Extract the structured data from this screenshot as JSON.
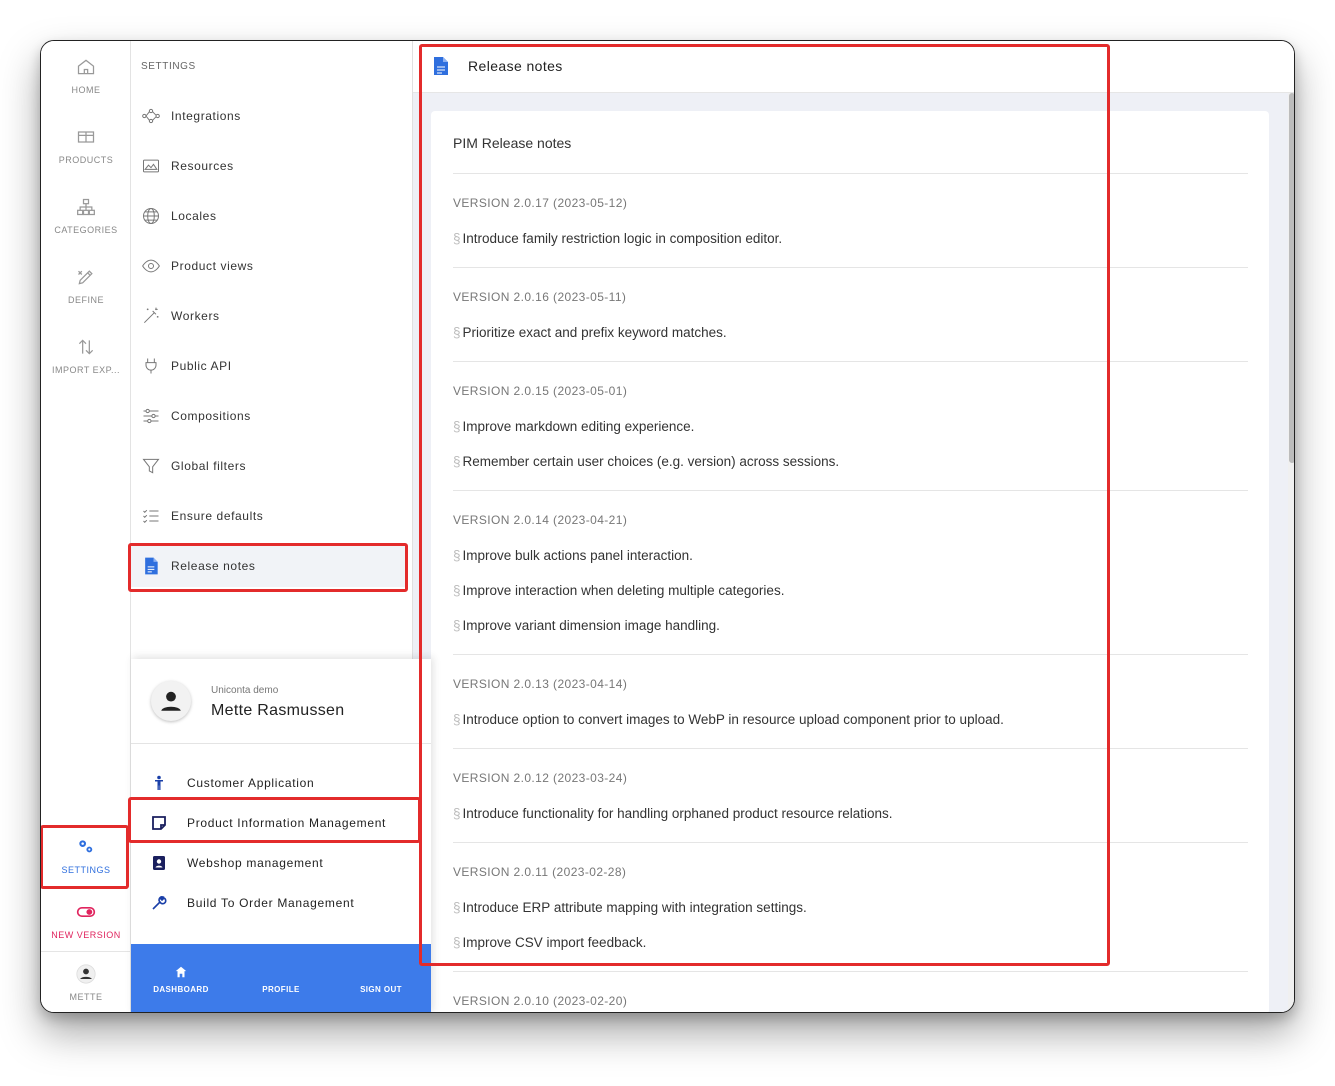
{
  "rail": {
    "items": [
      {
        "label": "HOME",
        "icon": "home-icon"
      },
      {
        "label": "PRODUCTS",
        "icon": "products-icon"
      },
      {
        "label": "CATEGORIES",
        "icon": "categories-icon"
      },
      {
        "label": "DEFINE",
        "icon": "define-icon"
      },
      {
        "label": "IMPORT EXP...",
        "icon": "import-export-icon"
      }
    ],
    "settings_label": "SETTINGS",
    "new_version_label": "NEW VERSION",
    "user_label": "METTE"
  },
  "settings": {
    "title": "SETTINGS",
    "items": [
      {
        "label": "Integrations",
        "icon": "integrations-icon"
      },
      {
        "label": "Resources",
        "icon": "resources-icon"
      },
      {
        "label": "Locales",
        "icon": "globe-icon"
      },
      {
        "label": "Product views",
        "icon": "eye-icon"
      },
      {
        "label": "Workers",
        "icon": "wand-icon"
      },
      {
        "label": "Public API",
        "icon": "plug-icon"
      },
      {
        "label": "Compositions",
        "icon": "sliders-icon"
      },
      {
        "label": "Global filters",
        "icon": "filter-icon"
      },
      {
        "label": "Ensure defaults",
        "icon": "checklist-icon"
      },
      {
        "label": "Release notes",
        "icon": "document-icon",
        "active": true
      }
    ]
  },
  "user_popup": {
    "company": "Uniconta demo",
    "name": "Mette Rasmussen",
    "apps": [
      {
        "label": "Customer Application",
        "icon": "person-icon"
      },
      {
        "label": "Product Information Management",
        "icon": "note-icon"
      },
      {
        "label": "Webshop management",
        "icon": "badge-icon"
      },
      {
        "label": "Build To Order Management",
        "icon": "wrench-icon"
      }
    ],
    "bottom_bar": {
      "dashboard": "DASHBOARD",
      "profile": "PROFILE",
      "sign_out": "SIGN OUT"
    }
  },
  "main": {
    "header_title": "Release notes",
    "card_title": "PIM Release notes",
    "versions": [
      {
        "version": "VERSION 2.0.17 (2023-05-12)",
        "notes": [
          "Introduce family restriction logic in composition editor."
        ]
      },
      {
        "version": "VERSION 2.0.16 (2023-05-11)",
        "notes": [
          "Prioritize exact and prefix keyword matches."
        ]
      },
      {
        "version": "VERSION 2.0.15 (2023-05-01)",
        "notes": [
          "Improve markdown editing experience.",
          "Remember certain user choices (e.g. version) across sessions."
        ]
      },
      {
        "version": "VERSION 2.0.14 (2023-04-21)",
        "notes": [
          "Improve bulk actions panel interaction.",
          "Improve interaction when deleting multiple categories.",
          "Improve variant dimension image handling."
        ]
      },
      {
        "version": "VERSION 2.0.13 (2023-04-14)",
        "notes": [
          "Introduce option to convert images to WebP in resource upload component prior to upload."
        ]
      },
      {
        "version": "VERSION 2.0.12 (2023-03-24)",
        "notes": [
          "Introduce functionality for handling orphaned product resource relations."
        ]
      },
      {
        "version": "VERSION 2.0.11 (2023-02-28)",
        "notes": [
          "Introduce ERP attribute mapping with integration settings.",
          "Improve CSV import feedback."
        ]
      },
      {
        "version": "VERSION 2.0.10 (2023-02-20)",
        "notes": []
      }
    ],
    "section_marker": "§"
  },
  "colors": {
    "accent": "#3d7bea",
    "highlight": "#e32b2b",
    "new_version": "#e0245e",
    "background": "#eef0f6"
  }
}
